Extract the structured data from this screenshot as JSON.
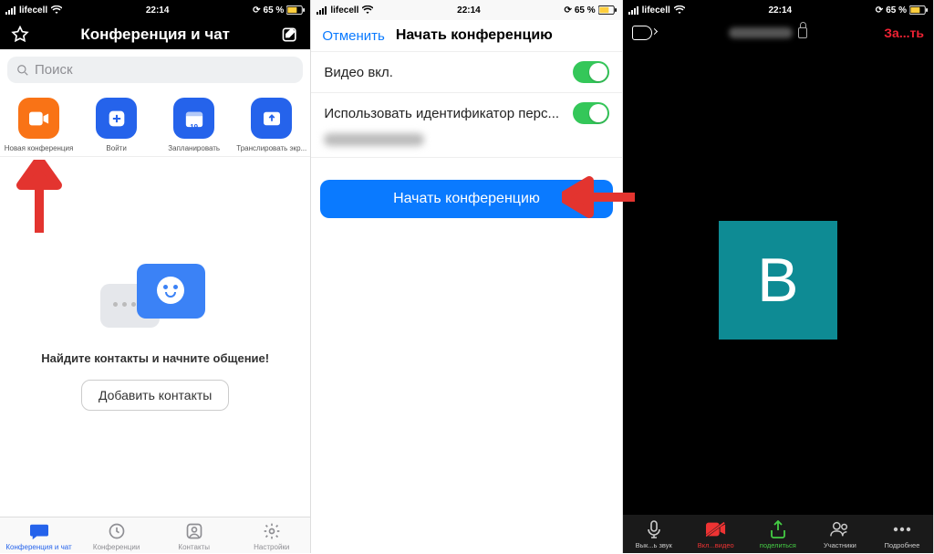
{
  "status": {
    "carrier": "lifecell",
    "time": "22:14",
    "battery": "65 %"
  },
  "screen1": {
    "title": "Конференция и чат",
    "search_placeholder": "Поиск",
    "actions": {
      "new_meeting": "Новая конференция",
      "join": "Войти",
      "schedule": "Запланировать",
      "schedule_day": "19",
      "share": "Транслировать экр..."
    },
    "empty_text": "Найдите контакты и начните общение!",
    "add_contacts": "Добавить контакты",
    "tabs": {
      "chat": "Конференция и чат",
      "meetings": "Конференции",
      "contacts": "Контакты",
      "settings": "Настройки"
    }
  },
  "screen2": {
    "cancel": "Отменить",
    "title": "Начать конференцию",
    "video_on": "Видео вкл.",
    "use_pmi": "Использовать идентификатор перс...",
    "start_button": "Начать конференцию"
  },
  "screen3": {
    "end": "За...ть",
    "avatar_letter": "В",
    "bottom": {
      "mute": "Вык...ь звук",
      "video": "Вкл...видео",
      "share": "поделиться",
      "participants": "Участники",
      "more": "Подробнее"
    }
  }
}
